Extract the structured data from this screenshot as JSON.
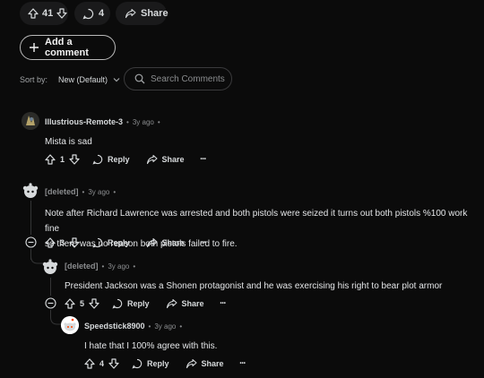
{
  "post_bar": {
    "score": "41",
    "comments": "4",
    "share": "Share"
  },
  "add_comment": "Add a comment",
  "sort": {
    "label": "Sort by:",
    "value": "New (Default)"
  },
  "search": {
    "placeholder": "Search Comments"
  },
  "comments": [
    {
      "author": "Illustrious-Remote-3",
      "time": "3y ago",
      "body": "Mista is sad",
      "score": "1",
      "reply": "Reply",
      "share": "Share",
      "more": "•••"
    },
    {
      "author": "[deleted]",
      "time": "3y ago",
      "body_line1": "Note after Richard Lawrence was arrested and both pistols were seized it turns out both pistols %100 work fine",
      "body_line2": "so there was no reason both pistols failed to fire.",
      "score": "3",
      "reply": "Reply",
      "share": "Share",
      "more": "•••"
    },
    {
      "author": "[deleted]",
      "time": "3y ago",
      "body": "President Jackson was a Shonen protagonist and he was exercising his right to bear plot armor",
      "score": "5",
      "reply": "Reply",
      "share": "Share",
      "more": "•••"
    },
    {
      "author": "Speedstick8900",
      "time": "3y ago",
      "body": "I hate that I 100% agree with this.",
      "score": "4",
      "reply": "Reply",
      "share": "Share",
      "more": "•••"
    }
  ],
  "separator": "•",
  "colors": {
    "background": "#0b0b0b",
    "pill": "#1a1a1b",
    "text": "#d7dadc",
    "muted": "#8a8c8e",
    "thread_line": "#343536"
  }
}
